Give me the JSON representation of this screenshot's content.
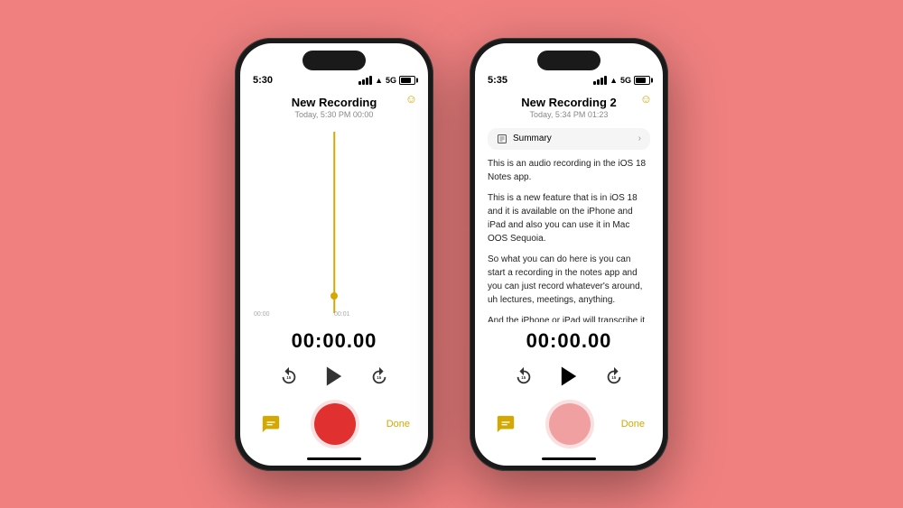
{
  "background_color": "#f08080",
  "phone1": {
    "status_time": "5:30",
    "recording_title": "New Recording",
    "recording_meta": "Today, 5:30 PM   00:00",
    "timer": "00:00.00",
    "skip_back_label": "15",
    "skip_forward_label": "15",
    "done_label": "Done",
    "timeline_labels": [
      "00:00",
      "00:01",
      ""
    ],
    "summary_icon": "📋",
    "chat_icon": "💬"
  },
  "phone2": {
    "status_time": "5:35",
    "recording_title": "New Recording 2",
    "recording_meta": "Today, 5:34 PM   01:23",
    "timer": "00:00.00",
    "skip_back_label": "15",
    "skip_forward_label": "15",
    "done_label": "Done",
    "summary_label": "Summary",
    "transcript_paragraphs": [
      "This is an audio recording in the iOS 18 Notes app.",
      "This is a new feature that is in iOS 18 and it is available on the iPhone and iPad and also you can use it in Mac OOS Sequoia.",
      "So what you can do here is you can start a recording in the notes app and you can just record whatever's around, uh lectures, meetings, anything.",
      "And the iPhone or iPad will transcribe it for you um right there so you can search"
    ],
    "chat_icon": "💬"
  }
}
